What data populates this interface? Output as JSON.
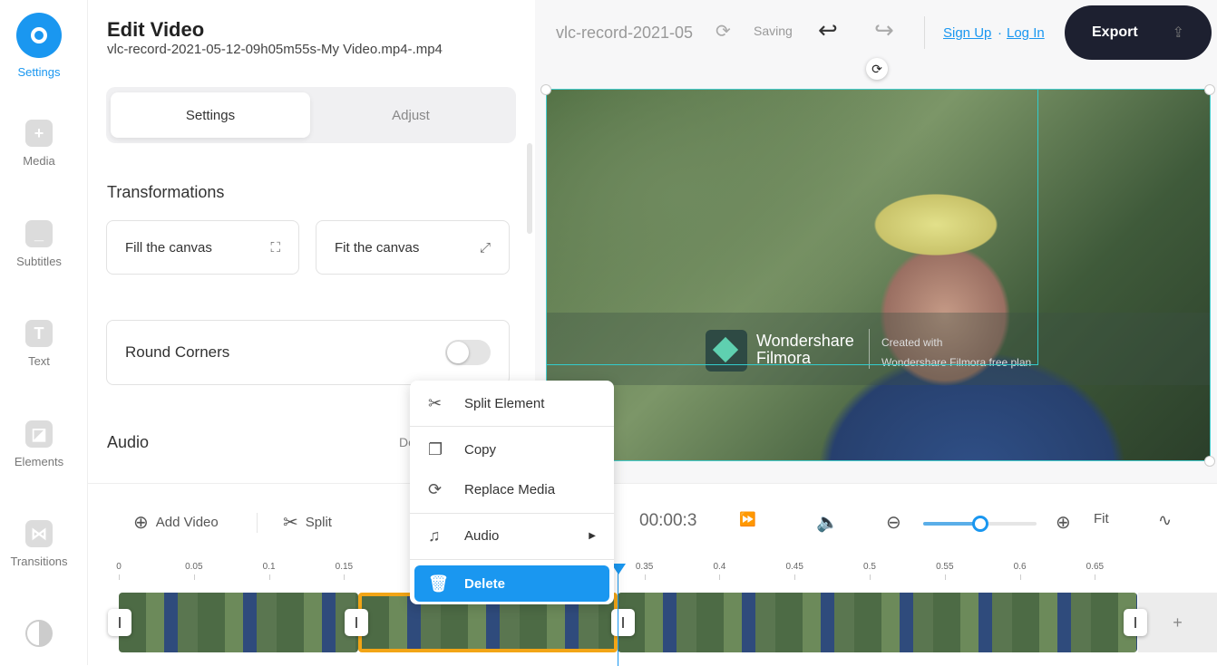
{
  "sidebar": {
    "items": [
      {
        "label": "Settings",
        "icon": "settings-icon",
        "active": true
      },
      {
        "label": "Media",
        "icon": "plus-icon"
      },
      {
        "label": "Subtitles",
        "icon": "subtitles-icon"
      },
      {
        "label": "Text",
        "icon": "text-icon"
      },
      {
        "label": "Elements",
        "icon": "elements-icon"
      },
      {
        "label": "Transitions",
        "icon": "transitions-icon"
      },
      {
        "label": "",
        "icon": "filter-icon"
      }
    ]
  },
  "panel": {
    "title": "Edit Video",
    "filename": "vlc-record-2021-05-12-09h05m55s-My Video.mp4-.mp4",
    "tabs": [
      {
        "label": "Settings",
        "active": true
      },
      {
        "label": "Adjust"
      }
    ],
    "transformations": "Transformations",
    "fill": "Fill the canvas",
    "fit": "Fit the canvas",
    "round_corners": "Round Corners",
    "round_corners_on": false,
    "audio": "Audio",
    "audio_right": "De"
  },
  "topbar": {
    "project": "vlc-record-2021-05",
    "status": "Saving",
    "signup": "Sign Up",
    "sep": "·",
    "login": "Log In",
    "export": "Export"
  },
  "watermark": {
    "brand1": "Wondershare",
    "brand2": "Filmora",
    "line1": "Created with",
    "line2": "Wondershare Filmora free plan"
  },
  "context_menu": {
    "items": [
      "Split Element",
      "Copy",
      "Replace Media",
      "Audio",
      "Delete"
    ]
  },
  "timeline": {
    "add_video": "Add Video",
    "split": "Split",
    "time": "00:00:3",
    "fit": "Fit",
    "zoom_level": 0.5,
    "ticks": [
      "0",
      "0.05",
      "0.1",
      "0.15",
      "0.35",
      "0.4",
      "0.45",
      "0.5",
      "0.55",
      "0.6",
      "0.65"
    ],
    "add": "+"
  },
  "colors": {
    "accent": "#1a97f0",
    "selection": "#f2a516",
    "export_bg": "#1d2030"
  }
}
